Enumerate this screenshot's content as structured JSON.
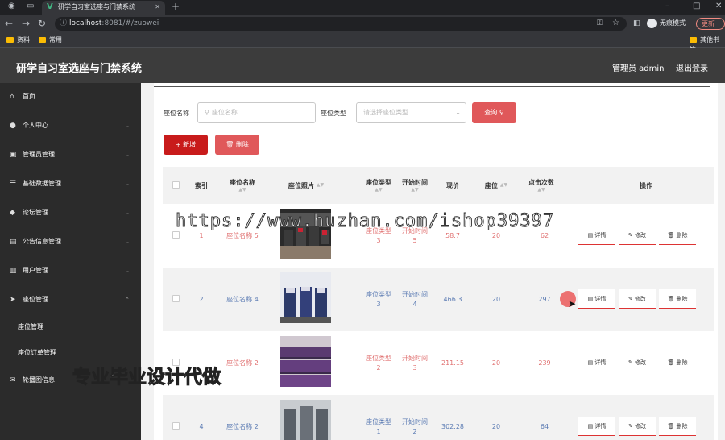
{
  "browser": {
    "tab_title": "研学自习室选座与门禁系统",
    "tab_close": "✕",
    "new_tab": "+",
    "url_host": "localhost",
    "url_rest": ":8081/#/zuowei",
    "profile_label": "无痕模式",
    "update_label": "更新",
    "bookmarks": [
      "资料",
      "常用"
    ],
    "other_bookmarks": "其他书签",
    "window_controls": [
      "–",
      "□",
      "✕"
    ]
  },
  "header": {
    "title": "研学自习室选座与门禁系统",
    "admin": "管理员 admin",
    "logout": "退出登录"
  },
  "sidebar": {
    "items": [
      {
        "label": "首页",
        "icon": "home-icon",
        "glyph": "⌂",
        "chevron": ""
      },
      {
        "label": "个人中心",
        "icon": "user-icon",
        "glyph": "●",
        "chevron": "⌄"
      },
      {
        "label": "管理员管理",
        "icon": "admin-icon",
        "glyph": "▣",
        "chevron": "⌄"
      },
      {
        "label": "基础数据管理",
        "icon": "list-icon",
        "glyph": "☰",
        "chevron": "⌄"
      },
      {
        "label": "论坛管理",
        "icon": "forum-icon",
        "glyph": "◆",
        "chevron": "⌄"
      },
      {
        "label": "公告信息管理",
        "icon": "notice-icon",
        "glyph": "▤",
        "chevron": "⌄"
      },
      {
        "label": "用户管理",
        "icon": "users-icon",
        "glyph": "▥",
        "chevron": "⌄"
      },
      {
        "label": "座位管理",
        "icon": "send-icon",
        "glyph": "➤",
        "chevron": "⌃"
      }
    ],
    "sub_items": [
      "座位管理",
      "座位订单管理"
    ],
    "last_item": {
      "label": "轮播图信息",
      "icon": "carousel-icon",
      "glyph": "✉"
    }
  },
  "search": {
    "name_label": "座位名称",
    "name_placeholder": "座位名称",
    "type_label": "座位类型",
    "type_placeholder": "请选择座位类型",
    "query_label": "查询 ⚲",
    "add_label": "+ 新增",
    "delete_label": "🗑 删除"
  },
  "table": {
    "headers": {
      "index": "索引",
      "name": "座位名称",
      "photo": "座位照片",
      "type": "座位类型",
      "start": "开始时间",
      "price": "现价",
      "seat": "座位",
      "clicks": "点击次数",
      "ops": "操作"
    },
    "sort_glyph": "▲▼",
    "rows": [
      {
        "index": "1",
        "name": "座位名称 5",
        "type": "座位类型 3",
        "start": "开始时间 5",
        "price": "58.7",
        "seat": "20",
        "clicks": "62",
        "color": "red"
      },
      {
        "index": "2",
        "name": "座位名称 4",
        "type": "座位类型 3",
        "start": "开始时间 4",
        "price": "466.3",
        "seat": "20",
        "clicks": "297",
        "color": "blue"
      },
      {
        "index": "",
        "name": "座位名称 2",
        "type": "座位类型 2",
        "start": "开始时间 3",
        "price": "211.15",
        "seat": "20",
        "clicks": "239",
        "color": "red"
      },
      {
        "index": "4",
        "name": "座位名称 2",
        "type": "座位类型 1",
        "start": "开始时间 2",
        "price": "302.28",
        "seat": "20",
        "clicks": "64",
        "color": "blue"
      }
    ],
    "ops": {
      "detail": "▤ 详情",
      "edit": "✎ 修改",
      "delete": "🗑 删除"
    }
  },
  "watermarks": {
    "url": "https://www.huzhan.com/ishop39397",
    "cn": "专业毕业设计代做"
  }
}
